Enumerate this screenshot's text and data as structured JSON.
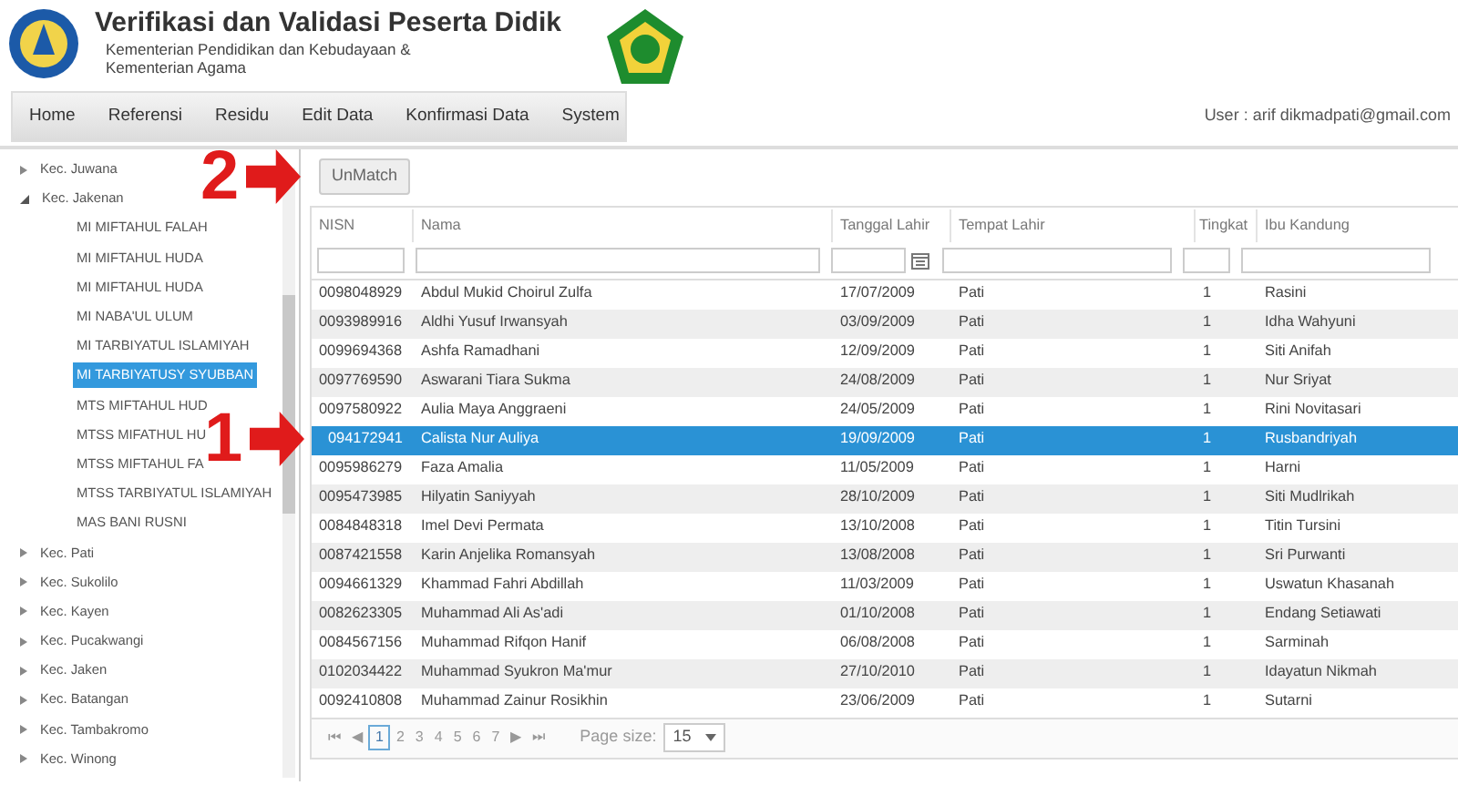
{
  "header": {
    "title": "Verifikasi dan Validasi Peserta Didik",
    "subtitle_lines": [
      "Kementerian Pendidikan dan Kebudayaan &",
      "Kementerian Agama"
    ]
  },
  "menu": [
    {
      "label": "Home"
    },
    {
      "label": "Referensi"
    },
    {
      "label": "Residu"
    },
    {
      "label": "Edit Data"
    },
    {
      "label": "Konfirmasi Data"
    },
    {
      "label": "System"
    }
  ],
  "user": "User : arif dikmadpati@gmail.com",
  "tree": [
    {
      "label": "Kec. Juwana",
      "expanded": false,
      "selected": false
    },
    {
      "label": "Kec. Jakenan",
      "expanded": true,
      "selected": false,
      "children": [
        {
          "label": "MI MIFTAHUL FALAH",
          "selected": false
        },
        {
          "label": "MI MIFTAHUL HUDA",
          "selected": false
        },
        {
          "label": "MI MIFTAHUL HUDA",
          "selected": false
        },
        {
          "label": "MI NABA'UL ULUM",
          "selected": false
        },
        {
          "label": "MI TARBIYATUL ISLAMIYAH",
          "selected": false
        },
        {
          "label": "MI TARBIYATUSY SYUBBAN",
          "selected": true
        },
        {
          "label": "MTS MIFTAHUL HUD",
          "selected": false
        },
        {
          "label": "MTSS MIFATHUL HU",
          "selected": false
        },
        {
          "label": "MTSS MIFTAHUL FA",
          "selected": false
        },
        {
          "label": "MTSS TARBIYATUL ISLAMIYAH",
          "selected": false
        },
        {
          "label": "MAS BANI RUSNI",
          "selected": false
        }
      ]
    },
    {
      "label": "Kec. Pati",
      "expanded": false,
      "selected": false
    },
    {
      "label": "Kec. Sukolilo",
      "expanded": false,
      "selected": false
    },
    {
      "label": "Kec. Kayen",
      "expanded": false,
      "selected": false
    },
    {
      "label": "Kec. Pucakwangi",
      "expanded": false,
      "selected": false
    },
    {
      "label": "Kec. Jaken",
      "expanded": false,
      "selected": false
    },
    {
      "label": "Kec. Batangan",
      "expanded": false,
      "selected": false
    },
    {
      "label": "Kec. Tambakromo",
      "expanded": false,
      "selected": false
    },
    {
      "label": "Kec. Winong",
      "expanded": false,
      "selected": false
    }
  ],
  "unmatch_button": "UnMatch",
  "annotations": [
    {
      "number": "2"
    },
    {
      "number": "1"
    }
  ],
  "table": {
    "columns": [
      "NISN",
      "Nama",
      "Tanggal Lahir",
      "Tempat Lahir",
      "Tingkat",
      "Ibu Kandung"
    ],
    "rows": [
      {
        "cells": [
          "0098048929",
          "Abdul Mukid Choirul Zulfa",
          "17/07/2009",
          "Pati",
          "1",
          "Rasini"
        ],
        "selected": false
      },
      {
        "cells": [
          "0093989916",
          "Aldhi Yusuf Irwansyah",
          "03/09/2009",
          "Pati",
          "1",
          "Idha Wahyuni"
        ],
        "selected": false
      },
      {
        "cells": [
          "0099694368",
          "Ashfa Ramadhani",
          "12/09/2009",
          "Pati",
          "1",
          "Siti Anifah"
        ],
        "selected": false
      },
      {
        "cells": [
          "0097769590",
          "Aswarani Tiara Sukma",
          "24/08/2009",
          "Pati",
          "1",
          "Nur Sriyat"
        ],
        "selected": false
      },
      {
        "cells": [
          "0097580922",
          "Aulia Maya Anggraeni",
          "24/05/2009",
          "Pati",
          "1",
          "Rini Novitasari"
        ],
        "selected": false
      },
      {
        "cells": [
          "094172941",
          "Calista Nur Auliya",
          "19/09/2009",
          "Pati",
          "1",
          "Rusbandriyah"
        ],
        "selected": true
      },
      {
        "cells": [
          "0095986279",
          "Faza Amalia",
          "11/05/2009",
          "Pati",
          "1",
          "Harni"
        ],
        "selected": false
      },
      {
        "cells": [
          "0095473985",
          "Hilyatin Saniyyah",
          "28/10/2009",
          "Pati",
          "1",
          "Siti Mudlrikah"
        ],
        "selected": false
      },
      {
        "cells": [
          "0084848318",
          "Imel Devi Permata",
          "13/10/2008",
          "Pati",
          "1",
          "Titin Tursini"
        ],
        "selected": false
      },
      {
        "cells": [
          "0087421558",
          "Karin Anjelika Romansyah",
          "13/08/2008",
          "Pati",
          "1",
          "Sri Purwanti"
        ],
        "selected": false
      },
      {
        "cells": [
          "0094661329",
          "Khammad Fahri Abdillah",
          "11/03/2009",
          "Pati",
          "1",
          "Uswatun Khasanah"
        ],
        "selected": false
      },
      {
        "cells": [
          "0082623305",
          "Muhammad Ali As'adi",
          "01/10/2008",
          "Pati",
          "1",
          "Endang Setiawati"
        ],
        "selected": false
      },
      {
        "cells": [
          "0084567156",
          "Muhammad Rifqon Hanif",
          "06/08/2008",
          "Pati",
          "1",
          "Sarminah"
        ],
        "selected": false
      },
      {
        "cells": [
          "0102034422",
          "Muhammad Syukron Ma'mur",
          "27/10/2010",
          "Pati",
          "1",
          "Idayatun Nikmah"
        ],
        "selected": false
      },
      {
        "cells": [
          "0092410808",
          "Muhammad Zainur Rosikhin",
          "23/06/2009",
          "Pati",
          "1",
          "Sutarni"
        ],
        "selected": false
      }
    ]
  },
  "pager": {
    "first": "⏮",
    "prev": "◀",
    "pages": [
      {
        "label": "1",
        "selected": true
      },
      {
        "label": "2",
        "selected": false
      },
      {
        "label": "3",
        "selected": false
      },
      {
        "label": "4",
        "selected": false
      },
      {
        "label": "5",
        "selected": false
      },
      {
        "label": "6",
        "selected": false
      },
      {
        "label": "7",
        "selected": false
      }
    ],
    "next": "▶",
    "last": "⏭",
    "page_size_label": "Page size:",
    "page_size": "15"
  }
}
